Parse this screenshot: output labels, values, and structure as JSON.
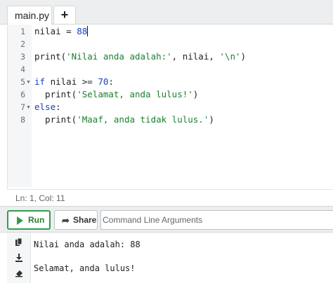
{
  "tabs": [
    {
      "label": "main.py"
    }
  ],
  "new_tab_label": "+",
  "editor": {
    "lines": [
      {
        "num": "1",
        "fold": "",
        "tokens": [
          {
            "t": "nilai = "
          },
          {
            "t": "88",
            "c": "num"
          }
        ],
        "cursor": true
      },
      {
        "num": "2",
        "fold": "",
        "tokens": []
      },
      {
        "num": "3",
        "fold": "",
        "tokens": [
          {
            "t": "print("
          },
          {
            "t": "'Nilai anda adalah:'",
            "c": "str"
          },
          {
            "t": ", nilai, "
          },
          {
            "t": "'\\n'",
            "c": "str"
          },
          {
            "t": ")"
          }
        ]
      },
      {
        "num": "4",
        "fold": "",
        "tokens": []
      },
      {
        "num": "5",
        "fold": "▼",
        "tokens": [
          {
            "t": "if",
            "c": "kw"
          },
          {
            "t": " nilai >= "
          },
          {
            "t": "70",
            "c": "num"
          },
          {
            "t": ":"
          }
        ]
      },
      {
        "num": "6",
        "fold": "",
        "tokens": [
          {
            "t": "  print("
          },
          {
            "t": "'Selamat, anda lulus!'",
            "c": "str"
          },
          {
            "t": ")"
          }
        ]
      },
      {
        "num": "7",
        "fold": "▼",
        "tokens": [
          {
            "t": "else",
            "c": "kw"
          },
          {
            "t": ":"
          }
        ]
      },
      {
        "num": "8",
        "fold": "",
        "tokens": [
          {
            "t": "  print("
          },
          {
            "t": "'Maaf, anda tidak lulus.'",
            "c": "str"
          },
          {
            "t": ")"
          }
        ]
      }
    ]
  },
  "status": {
    "position": "Ln: 1,  Col: 11"
  },
  "toolbar": {
    "run_label": "Run",
    "share_label": "Share",
    "args_placeholder": "Command Line Arguments"
  },
  "output": {
    "lines": [
      "Nilai anda adalah: 88",
      "",
      "Selamat, anda lulus!"
    ]
  },
  "colors": {
    "run_accent": "#2e9e4b",
    "keyword": "#1a3fbf",
    "string": "#1a7f2e"
  }
}
